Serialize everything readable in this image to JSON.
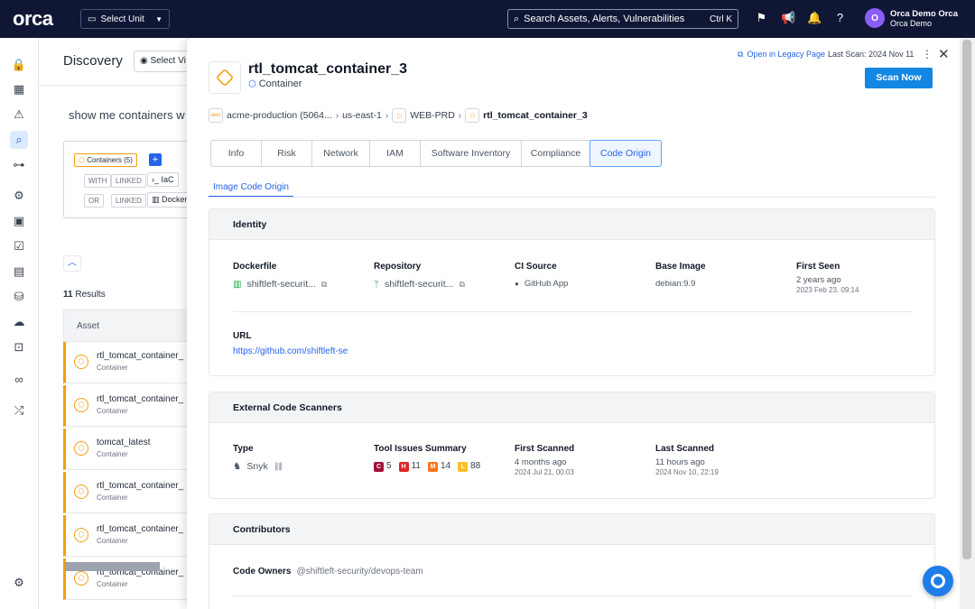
{
  "topbar": {
    "logo": "orca",
    "select_unit": "Select Unit",
    "search_placeholder": "Search Assets, Alerts, Vulnerabilities",
    "search_shortcut": "Ctrl K",
    "user_initial": "O",
    "user_name": "Orca Demo Orca",
    "user_org": "Orca Demo"
  },
  "discovery": {
    "title": "Discovery",
    "select_view": "Select Vi",
    "query_text": "show me containers w",
    "chips": {
      "containers": "Containers (5)",
      "with": "WITH",
      "linked": "LINKED",
      "iac": "IaC",
      "or": "OR",
      "linked2": "LINKED",
      "docker": "Docker"
    },
    "results_count": "11",
    "results_label": "Results",
    "column_asset": "Asset",
    "rows": [
      {
        "name": "rtl_tomcat_container_",
        "type": "Container"
      },
      {
        "name": "rtl_tomcat_container_",
        "type": "Container"
      },
      {
        "name": "tomcat_latest",
        "type": "Container"
      },
      {
        "name": "rtl_tomcat_container_",
        "type": "Container"
      },
      {
        "name": "rtl_tomcat_container_",
        "type": "Container"
      },
      {
        "name": "rtl_tomcat_container_",
        "type": "Container"
      }
    ]
  },
  "drawer": {
    "title": "rtl_tomcat_container_3",
    "subtitle": "Container",
    "legacy_link": "Open in Legacy Page",
    "last_scan_label": "Last Scan:",
    "last_scan_value": "2024 Nov 11",
    "scan_button": "Scan Now",
    "breadcrumb": {
      "account_icon": "aws",
      "account": "acme-production (5064...",
      "region": "us-east-1",
      "cluster": "WEB-PRD",
      "asset": "rtl_tomcat_container_3"
    },
    "tabs": [
      {
        "label": "Info",
        "active": false
      },
      {
        "label": "Risk",
        "active": false
      },
      {
        "label": "Network",
        "active": false
      },
      {
        "label": "IAM",
        "active": false
      },
      {
        "label": "Software Inventory",
        "active": false
      },
      {
        "label": "Compliance",
        "active": false
      },
      {
        "label": "Code Origin",
        "active": true
      }
    ],
    "subtab": "Image Code Origin",
    "identity": {
      "heading": "Identity",
      "dockerfile_label": "Dockerfile",
      "dockerfile_value": "shiftleft-securit...",
      "repository_label": "Repository",
      "repository_value": "shiftleft-securit...",
      "ci_label": "CI Source",
      "ci_value": "GitHub App",
      "base_image_label": "Base Image",
      "base_image_value": "debian:9.9",
      "first_seen_label": "First Seen",
      "first_seen_value": "2 years ago",
      "first_seen_date": "2023 Feb 23, 09:14",
      "url_label": "URL",
      "url_value": "https://github.com/shiftleft-se"
    },
    "scanners": {
      "heading": "External Code Scanners",
      "type_label": "Type",
      "type_value": "Snyk",
      "issues_label": "Tool Issues Summary",
      "issues": [
        {
          "sev": "C",
          "count": "5",
          "color": "#9f1239"
        },
        {
          "sev": "H",
          "count": "11",
          "color": "#dc2626"
        },
        {
          "sev": "M",
          "count": "14",
          "color": "#f97316"
        },
        {
          "sev": "L",
          "count": "88",
          "color": "#fbbf24"
        }
      ],
      "first_scanned_label": "First Scanned",
      "first_scanned_value": "4 months ago",
      "first_scanned_date": "2024 Jul 21, 00:03",
      "last_scanned_label": "Last Scanned",
      "last_scanned_value": "11 hours ago",
      "last_scanned_date": "2024 Nov 10, 22:19"
    },
    "contributors": {
      "heading": "Contributors",
      "code_owners_label": "Code Owners",
      "code_owners_value": "@shiftleft-security/devops-team"
    }
  }
}
